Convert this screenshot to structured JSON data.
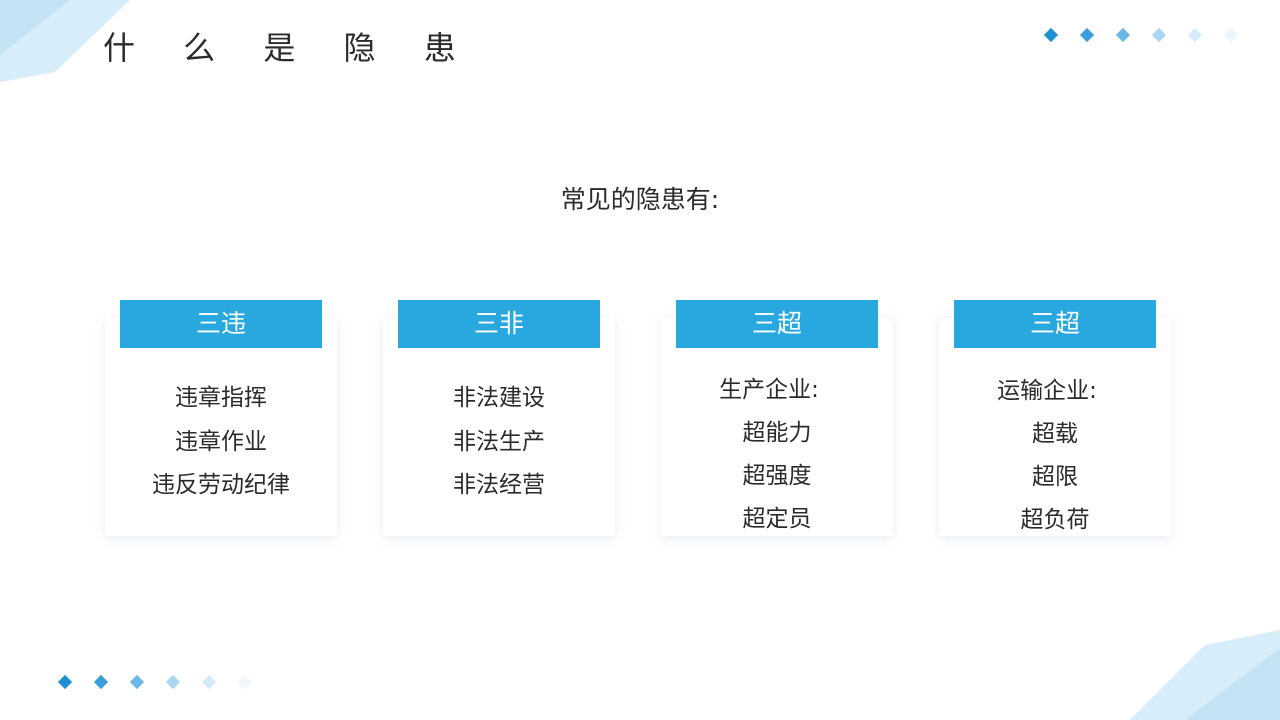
{
  "title": "什 么 是 隐 患",
  "subtitle": "常见的隐患有:",
  "colors": {
    "accent": "#29a8e0",
    "accent_light": "#bfe3f6",
    "dot_dark": "#1e8fd2"
  },
  "cards": [
    {
      "header": "三违",
      "lines": [
        "违章指挥",
        "违章作业",
        "违反劳动纪律"
      ]
    },
    {
      "header": "三非",
      "lines": [
        "非法建设",
        "非法生产",
        "非法经营"
      ]
    },
    {
      "header": "三超",
      "lines": [
        "生产企业:",
        "超能力",
        "超强度",
        "超定员"
      ]
    },
    {
      "header": "三超",
      "lines": [
        "运输企业:",
        "超载",
        "超限",
        "超负荷"
      ]
    }
  ]
}
